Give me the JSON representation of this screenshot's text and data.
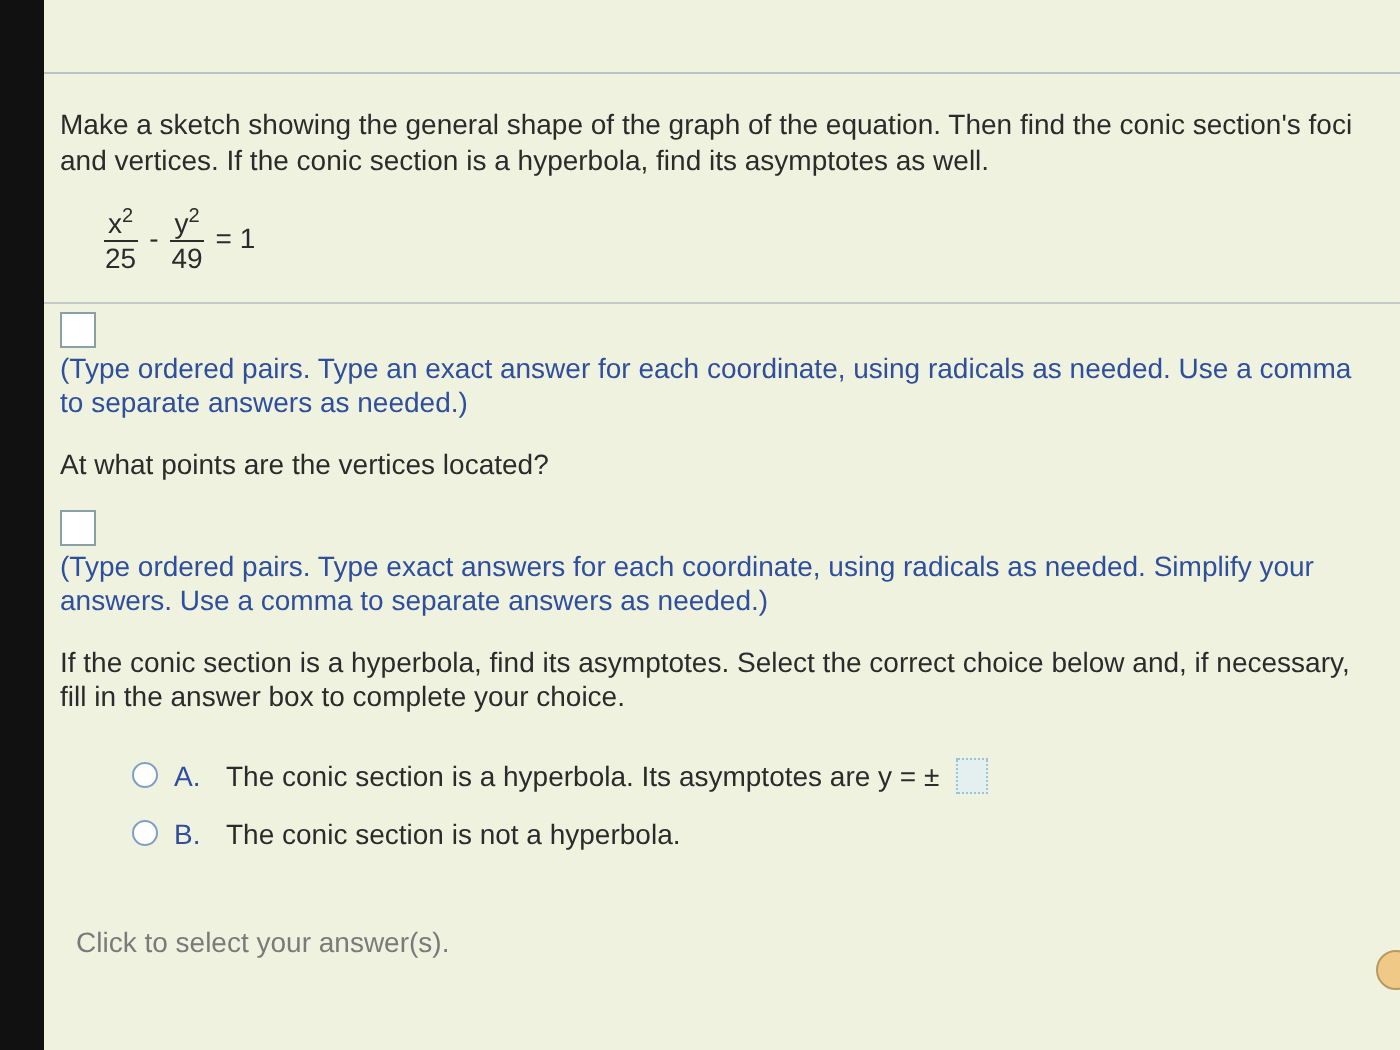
{
  "prompt": "Make a sketch showing the general shape of the graph of the equation. Then find the conic section's foci and vertices. If the conic section is a hyperbola, find its asymptotes as well.",
  "equation": {
    "terms": [
      {
        "numerator": "x",
        "exponent": "2",
        "denominator": "25"
      },
      {
        "numerator": "y",
        "exponent": "2",
        "denominator": "49"
      }
    ],
    "operator": "-",
    "rhs": "= 1"
  },
  "parts": [
    {
      "kind": "answer",
      "text": "(Type ordered pairs. Type an exact answer for each coordinate, using radicals as needed. Use a comma to separate answers as needed.)"
    },
    {
      "kind": "question",
      "text": "At what points are the vertices located?"
    },
    {
      "kind": "answer",
      "text": "(Type ordered pairs. Type exact answers for each coordinate, using radicals as needed. Simplify your answers. Use a comma to separate answers as needed.)"
    },
    {
      "kind": "question",
      "text": "If the conic section is a hyperbola, find its asymptotes. Select the correct choice below and, if necessary, fill in the answer box to complete your choice."
    }
  ],
  "choices": [
    {
      "kind": "with-box",
      "letter": "A.",
      "text": "The conic section is a hyperbola. Its asymptotes are y = ±",
      "selected": false
    },
    {
      "kind": "plain",
      "letter": "B.",
      "text": "The conic section is not a hyperbola.",
      "selected": false
    }
  ],
  "footer": "Click to select your answer(s)."
}
